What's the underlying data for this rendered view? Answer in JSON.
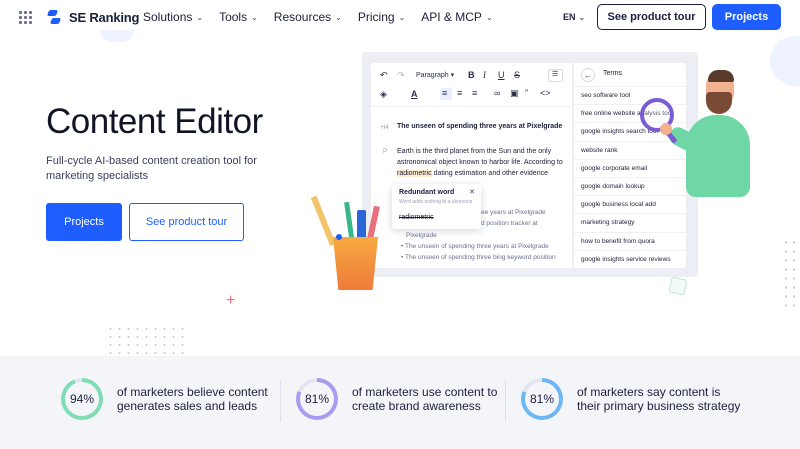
{
  "nav": {
    "brand": "SE Ranking",
    "menu": [
      "Solutions",
      "Tools",
      "Resources",
      "Pricing",
      "API & MCP"
    ],
    "lang": "EN",
    "tour_label": "See product tour",
    "projects_label": "Projects"
  },
  "hero": {
    "title": "Content Editor",
    "subtitle": "Full-cycle AI-based content creation tool for marketing specialists",
    "projects_label": "Projects",
    "tour_label": "See product tour"
  },
  "editor": {
    "paragraph_select": "Paragraph",
    "heading_tag": "H4",
    "heading_text": "The unseen of spending three years at Pixelgrade",
    "para_tag": "P",
    "para_text_before": "Earth is the third planet from the Sun and the only astronomical object known to harbor life. According to ",
    "para_highlight": "radiometric",
    "para_text_after": " dating estimation and other evidence",
    "popup_title": "Redundant word",
    "popup_sub": "Word adds nothing to a sentence",
    "popup_word": "radiometric",
    "faded_1": "ee years at Pixelgrade",
    "faded_2": "d position tracker at",
    "faded_3": "Pixelgrade",
    "bullet_1": "The unseen of spending three years at Pixelgrade",
    "bullet_2": "The unseen of spending three bing keyword position"
  },
  "terms": {
    "title": "Terms",
    "items": [
      "seo software tool",
      "free online website analysis tool",
      "google insights search tool",
      "website rank",
      "google corporate email",
      "google domain lookup",
      "google business local add",
      "marketing strategy",
      "how to benefit from quora",
      "google insights service reviews"
    ]
  },
  "stats": [
    {
      "value": "94%",
      "text": "of marketers believe content generates sales and leads",
      "color": "#7fdcb5",
      "fraction": 0.94
    },
    {
      "value": "81%",
      "text": "of marketers use content to create brand awareness",
      "color": "#a89cf0",
      "fraction": 0.81
    },
    {
      "value": "81%",
      "text": "of marketers say content is their primary business strategy",
      "color": "#6fb6f5",
      "fraction": 0.81
    }
  ],
  "colors": {
    "accent": "#1e5eff",
    "text": "#1b1f3b"
  }
}
